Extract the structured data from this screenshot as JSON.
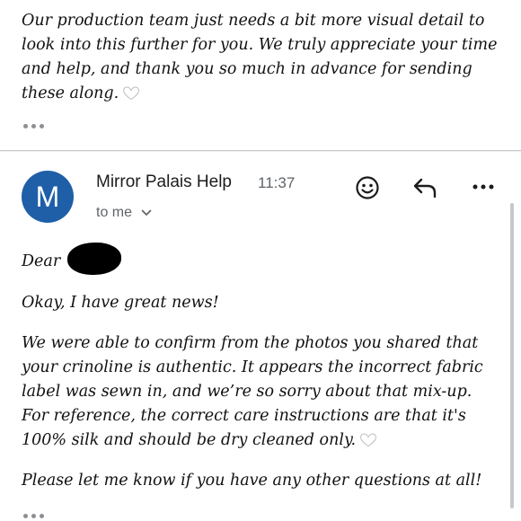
{
  "prev_message": {
    "body": "Our production team just needs a bit more visual detail to look into this further for you. We truly appreciate your time and help, and thank you so much in advance for sending these along."
  },
  "message": {
    "sender": "Mirror Palais Help",
    "time": "11:37",
    "avatar_letter": "M",
    "recipient": "to me",
    "greeting": "Dear",
    "paragraphs": [
      "Okay, I have great news!",
      "We were able to confirm from the photos you shared that your crinoline is authentic. It appears the incorrect fabric label was sewn in, and we’re so sorry about that mix-up. For reference, the correct care instructions are that it's 100% silk and should be dry cleaned only.",
      "Please let me know if you have any other questions at all!"
    ]
  },
  "colors": {
    "avatar": "#1e5fa8",
    "secondary_text": "#5f6368"
  },
  "icons": [
    "emoji-reaction-icon",
    "reply-icon",
    "more-options-icon",
    "white-heart-icon",
    "chevron-down-icon",
    "ellipsis-icon"
  ]
}
